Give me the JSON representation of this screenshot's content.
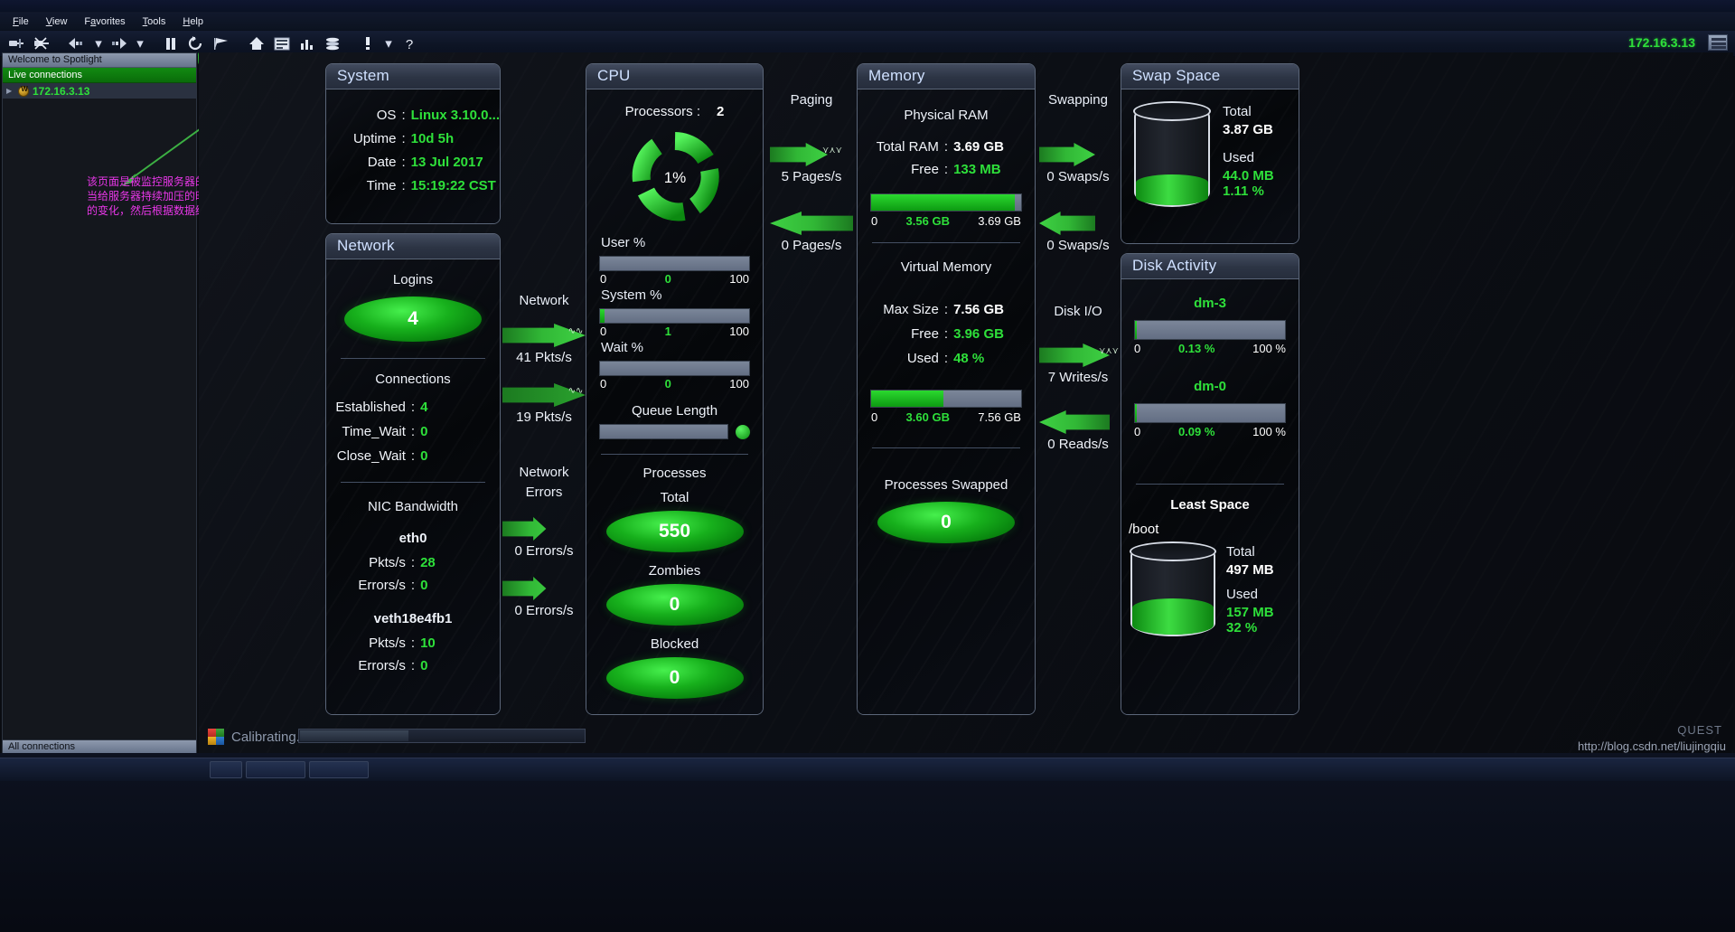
{
  "menu": {
    "items": [
      {
        "label": "File",
        "accel": "F"
      },
      {
        "label": "View",
        "accel": "V"
      },
      {
        "label": "Favorites",
        "accel": "a"
      },
      {
        "label": "Tools",
        "accel": "T"
      },
      {
        "label": "Help",
        "accel": "H"
      }
    ]
  },
  "toolbar": {
    "buttons": [
      {
        "name": "connect-icon",
        "glyph": "⬛—",
        "title": "Connect"
      },
      {
        "name": "disconnect-icon",
        "glyph": "✖",
        "title": "Disconnect"
      },
      {
        "name": "back-icon",
        "glyph": "⬅",
        "title": "Back"
      },
      {
        "name": "back-dropdown-icon",
        "glyph": "▾",
        "title": "Back history"
      },
      {
        "name": "forward-icon",
        "glyph": "➡",
        "title": "Forward"
      },
      {
        "name": "forward-dropdown-icon",
        "glyph": "▾",
        "title": "Forward history"
      },
      {
        "name": "pause-icon",
        "glyph": "Ⅱ",
        "title": "Pause"
      },
      {
        "name": "refresh-icon",
        "glyph": "↺",
        "title": "Refresh"
      },
      {
        "name": "flag-icon",
        "glyph": "⚑",
        "title": "Playback"
      },
      {
        "name": "home-icon",
        "glyph": "⌂",
        "title": "Home page"
      },
      {
        "name": "grid-icon",
        "glyph": "▤",
        "title": "Details"
      },
      {
        "name": "chart-icon",
        "glyph": "█",
        "title": "Charts"
      },
      {
        "name": "database-icon",
        "glyph": "≡",
        "title": "Data"
      },
      {
        "name": "alarm-icon",
        "glyph": "!",
        "title": "Alarms"
      },
      {
        "name": "alarm-dropdown-icon",
        "glyph": "▾",
        "title": "Alarm options"
      },
      {
        "name": "help-icon",
        "glyph": "?",
        "title": "Help"
      }
    ],
    "host": "172.16.3.13"
  },
  "tree": {
    "header": "Welcome to Spotlight",
    "selected": "Live connections",
    "node": "172.16.3.13",
    "footer": "All connections"
  },
  "annotation": {
    "lines": "该页面是被监控服务器的基本信息。\n当给服务器持续加压的时候，可以看到对应的参数\n的变化，然后根据数据结果进行判断。",
    "color": "#e837e8"
  },
  "panels": {
    "system": {
      "title": "System",
      "rows": [
        {
          "label": "OS",
          "value": "Linux 3.10.0...",
          "style": "green"
        },
        {
          "label": "Uptime",
          "value": "10d 5h",
          "style": "green"
        },
        {
          "label": "Date",
          "value": "13 Jul 2017",
          "style": "green"
        },
        {
          "label": "Time",
          "value": "15:19:22 CST",
          "style": "green"
        }
      ]
    },
    "network": {
      "title": "Network",
      "logins_label": "Logins",
      "logins_value": "4",
      "connections_label": "Connections",
      "connections": [
        {
          "label": "Established",
          "value": "4"
        },
        {
          "label": "Time_Wait",
          "value": "0"
        },
        {
          "label": "Close_Wait",
          "value": "0"
        }
      ],
      "nic_label": "NIC Bandwidth",
      "nics": [
        {
          "name": "eth0",
          "rows": [
            {
              "label": "Pkts/s",
              "value": "28"
            },
            {
              "label": "Errors/s",
              "value": "0"
            }
          ]
        },
        {
          "name": "veth18e4fb1",
          "rows": [
            {
              "label": "Pkts/s",
              "value": "10"
            },
            {
              "label": "Errors/s",
              "value": "0"
            }
          ]
        }
      ]
    },
    "cpu": {
      "title": "CPU",
      "processors_label": "Processors :",
      "processors_value": "2",
      "gauge_value": "1%",
      "bars": [
        {
          "label": "User %",
          "min": "0",
          "mid": "0",
          "max": "100",
          "pct": 0
        },
        {
          "label": "System %",
          "min": "0",
          "mid": "1",
          "max": "100",
          "pct": 1.5
        },
        {
          "label": "Wait %",
          "min": "0",
          "mid": "0",
          "max": "100",
          "pct": 0
        }
      ],
      "queue_label": "Queue Length",
      "processes_label": "Processes",
      "process_items": [
        {
          "label": "Total",
          "value": "550"
        },
        {
          "label": "Zombies",
          "value": "0"
        },
        {
          "label": "Blocked",
          "value": "0"
        }
      ]
    },
    "memory": {
      "title": "Memory",
      "physical_label": "Physical RAM",
      "physical_rows": [
        {
          "label": "Total RAM",
          "value": "3.69 GB",
          "style": "white"
        },
        {
          "label": "Free",
          "value": "133 MB",
          "style": "green"
        }
      ],
      "physical_bar": {
        "min": "0",
        "mid": "3.56 GB",
        "max": "3.69 GB",
        "pct": 96
      },
      "virtual_label": "Virtual Memory",
      "virtual_rows": [
        {
          "label": "Max Size",
          "value": "7.56 GB",
          "style": "white"
        },
        {
          "label": "Free",
          "value": "3.96 GB",
          "style": "green"
        },
        {
          "label": "Used",
          "value": "48 %",
          "style": "green"
        }
      ],
      "virtual_bar": {
        "min": "0",
        "mid": "3.60 GB",
        "max": "7.56 GB",
        "pct": 48
      },
      "swapped_label": "Processes Swapped",
      "swapped_value": "0"
    },
    "swap": {
      "title": "Swap Space",
      "total_label": "Total",
      "total_value": "3.87 GB",
      "used_label": "Used",
      "used_value": "44.0 MB",
      "used_pct": "1.11 %"
    },
    "disk": {
      "title": "Disk Activity",
      "devices": [
        {
          "name": "dm-3",
          "min": "0",
          "mid": "0.13 %",
          "max": "100 %",
          "pct": 0.13
        },
        {
          "name": "dm-0",
          "min": "0",
          "mid": "0.09 %",
          "max": "100 %",
          "pct": 0.09
        }
      ],
      "least_space_label": "Least Space",
      "mount": "/boot",
      "total_label": "Total",
      "total_value": "497 MB",
      "used_label": "Used",
      "used_value": "157 MB",
      "used_pct": "32 %"
    }
  },
  "flows": {
    "network": {
      "label_line1": "Network",
      "values": [
        "41 Pkts/s",
        "19 Pkts/s"
      ]
    },
    "network_errors": {
      "label_line1": "Network",
      "label_line2": "Errors",
      "values": [
        "0 Errors/s",
        "0 Errors/s"
      ]
    },
    "paging": {
      "label_line1": "Paging",
      "values": [
        "5 Pages/s",
        "0 Pages/s"
      ]
    },
    "swapping": {
      "label_line1": "Swapping",
      "values": [
        "0 Swaps/s",
        "0 Swaps/s"
      ]
    },
    "diskio": {
      "label_line1": "Disk I/O",
      "values": [
        "7 Writes/s",
        "0 Reads/s"
      ]
    }
  },
  "status": {
    "calibrating": "Calibrating...",
    "watermark": "http://blog.csdn.net/liujingqiu",
    "brand": "QUEST"
  },
  "colors": {
    "accent_green": "#2ee03a",
    "panel_border": "#5b6679",
    "header_text": "#cfe0ff",
    "annotation": "#e837e8"
  }
}
